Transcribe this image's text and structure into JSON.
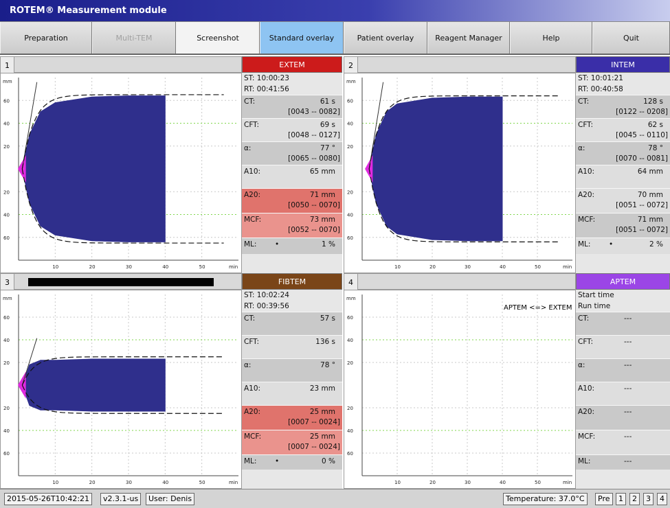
{
  "app_title": "ROTEM® Measurement module",
  "toolbar": [
    {
      "label": "Preparation"
    },
    {
      "label": "Multi-TEM"
    },
    {
      "label": "Screenshot"
    },
    {
      "label": "Standard overlay"
    },
    {
      "label": "Patient overlay"
    },
    {
      "label": "Reagent Manager"
    },
    {
      "label": "Help"
    },
    {
      "label": "Quit"
    }
  ],
  "panels": [
    {
      "num": "1",
      "test": "EXTEM",
      "color": "#cc1b1b",
      "st": "ST: 10:00:23",
      "rt": "RT: 00:41:56",
      "ct": {
        "label": "CT:",
        "value": "61 s",
        "range": "[0043 -- 0082]"
      },
      "cft": {
        "label": "CFT:",
        "value": "69 s",
        "range": "[0048 -- 0127]"
      },
      "alpha": {
        "label": "α:",
        "value": "77 °",
        "range": "[0065 -- 0080]"
      },
      "a10": {
        "label": "A10:",
        "value": "65 mm"
      },
      "a20": {
        "label": "A20:",
        "value": "71 mm",
        "range": "[0050 -- 0070]"
      },
      "mcf": {
        "label": "MCF:",
        "value": "73 mm",
        "range": "[0052 -- 0070]"
      },
      "ml": {
        "label": "ML:",
        "marker": "•",
        "value": "1 %"
      }
    },
    {
      "num": "2",
      "test": "INTEM",
      "color": "#3a2ea8",
      "st": "ST: 10:01:21",
      "rt": "RT: 00:40:58",
      "ct": {
        "label": "CT:",
        "value": "128 s",
        "range": "[0122 -- 0208]"
      },
      "cft": {
        "label": "CFT:",
        "value": "62 s",
        "range": "[0045 -- 0110]"
      },
      "alpha": {
        "label": "α:",
        "value": "78 °",
        "range": "[0070 -- 0081]"
      },
      "a10": {
        "label": "A10:",
        "value": "64 mm"
      },
      "a20": {
        "label": "A20:",
        "value": "70 mm",
        "range": "[0051 -- 0072]"
      },
      "mcf": {
        "label": "MCF:",
        "value": "71 mm",
        "range": "[0051 -- 0072]"
      },
      "ml": {
        "label": "ML:",
        "marker": "•",
        "value": "2 %"
      }
    },
    {
      "num": "3",
      "test": "FIBTEM",
      "color": "#7a4518",
      "st": "ST: 10:02:24",
      "rt": "RT: 00:39:56",
      "ct": {
        "label": "CT:",
        "value": "57 s"
      },
      "cft": {
        "label": "CFT:",
        "value": "136 s"
      },
      "alpha": {
        "label": "α:",
        "value": "78 °"
      },
      "a10": {
        "label": "A10:",
        "value": "23 mm"
      },
      "a20": {
        "label": "A20:",
        "value": "25 mm",
        "range": "[0007 -- 0024]"
      },
      "mcf": {
        "label": "MCF:",
        "value": "25 mm",
        "range": "[0007 -- 0024]"
      },
      "ml": {
        "label": "ML:",
        "marker": "•",
        "value": "0 %"
      }
    },
    {
      "num": "4",
      "test": "APTEM",
      "color": "#9b45e6",
      "st": "Start time",
      "rt": "Run time",
      "overlay_label": "APTEM <=> EXTEM",
      "ct": {
        "label": "CT:",
        "value": "---"
      },
      "cft": {
        "label": "CFT:",
        "value": "---"
      },
      "alpha": {
        "label": "α:",
        "value": "---"
      },
      "a10": {
        "label": "A10:",
        "value": "---"
      },
      "a20": {
        "label": "A20:",
        "value": "---"
      },
      "mcf": {
        "label": "MCF:",
        "value": "---"
      },
      "ml": {
        "label": "ML:",
        "value": "---"
      }
    }
  ],
  "axis": {
    "unit_y": "mm",
    "unit_x": "min",
    "y_ticks": [
      "60",
      "40",
      "20",
      "20",
      "40",
      "60"
    ],
    "x_ticks": [
      "10",
      "20",
      "30",
      "40",
      "50"
    ]
  },
  "chart_data": [
    {
      "type": "area",
      "title": "EXTEM",
      "xlabel": "min",
      "ylabel": "mm",
      "xlim": [
        0,
        60
      ],
      "ylim": [
        -80,
        80
      ],
      "x": [
        1,
        3,
        6,
        10,
        20,
        30,
        40
      ],
      "y": [
        0,
        30,
        50,
        58,
        63,
        64,
        64
      ],
      "reference_dashed_y": 65,
      "grid": true
    },
    {
      "type": "area",
      "title": "INTEM",
      "xlabel": "min",
      "ylabel": "mm",
      "xlim": [
        0,
        60
      ],
      "ylim": [
        -80,
        80
      ],
      "x": [
        2,
        4,
        7,
        10,
        20,
        30,
        40
      ],
      "y": [
        0,
        30,
        50,
        57,
        62,
        63,
        63
      ],
      "reference_dashed_y": 64,
      "grid": true
    },
    {
      "type": "area",
      "title": "FIBTEM",
      "xlabel": "min",
      "ylabel": "mm",
      "xlim": [
        0,
        60
      ],
      "ylim": [
        -80,
        80
      ],
      "x": [
        1,
        3,
        6,
        10,
        20,
        30,
        40
      ],
      "y": [
        0,
        18,
        22,
        22,
        23,
        23,
        23
      ],
      "reference_dashed_y": 25,
      "grid": true
    },
    {
      "type": "area",
      "title": "APTEM",
      "xlabel": "min",
      "ylabel": "mm",
      "xlim": [
        0,
        60
      ],
      "ylim": [
        -80,
        80
      ],
      "x": [],
      "y": [],
      "grid": true
    }
  ],
  "status": {
    "datetime": "2015-05-26T10:42:21",
    "version": "v2.3.1-us",
    "user": "User: Denis",
    "temperature": "Temperature: 37.0°C",
    "pre": "Pre",
    "channels": [
      "1",
      "2",
      "3",
      "4"
    ]
  }
}
